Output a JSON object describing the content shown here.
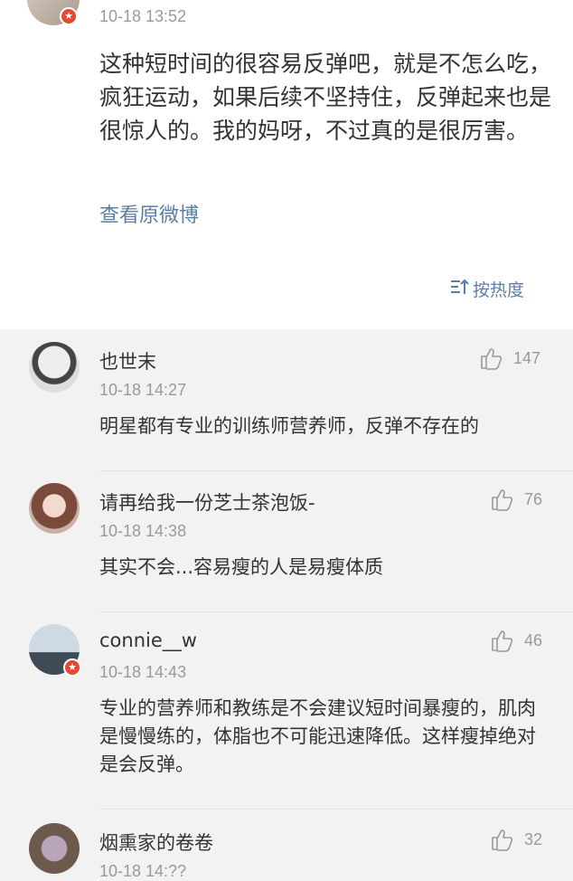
{
  "post": {
    "timestamp": "10-18 13:52",
    "text": "这种短时间的很容易反弹吧，就是不怎么吃，疯狂运动，如果后续不坚持住，反弹起来也是很惊人的。我的妈呀，不过真的是很厉害。",
    "view_original_link": "查看原微博",
    "sort_label": "按热度",
    "sort_icon": "sort-icon"
  },
  "comments": [
    {
      "name": "也世末",
      "time": "10-18 14:27",
      "likes": "147",
      "text": "明星都有专业的训练师营养师，反弹不存在的"
    },
    {
      "name": "请再给我一份芝士茶泡饭-",
      "time": "10-18 14:38",
      "likes": "76",
      "text": "其实不会...容易瘦的人是易瘦体质"
    },
    {
      "name": "connie__w",
      "time": "10-18 14:43",
      "likes": "46",
      "text": "专业的营养师和教练是不会建议短时间暴瘦的，肌肉是慢慢练的，体脂也不可能迅速降低。这样瘦掉绝对是会反弹。"
    },
    {
      "name": "烟熏家的卷卷",
      "time": "10-18 14:??",
      "likes": "32",
      "text": ""
    }
  ],
  "colors": {
    "accent_link": "#5b7ea8",
    "badge": "#e8472f",
    "muted": "#9a9a9a"
  }
}
